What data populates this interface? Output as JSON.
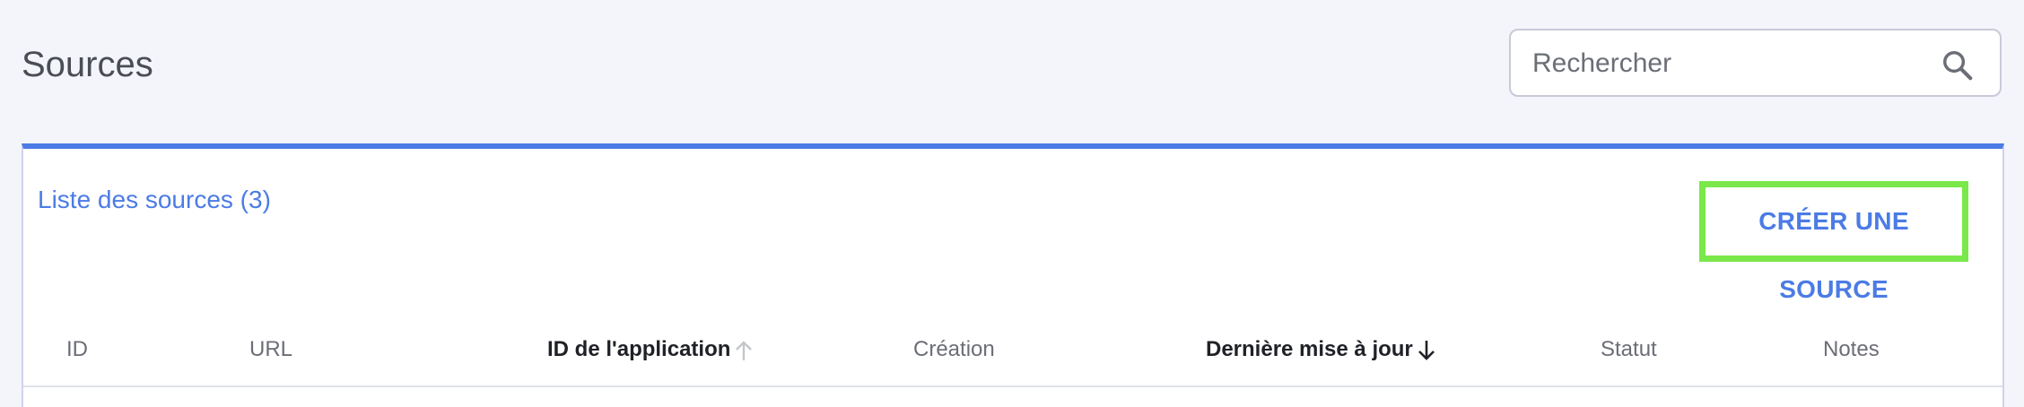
{
  "header": {
    "title": "Sources"
  },
  "search": {
    "placeholder": "Rechercher",
    "value": "",
    "icon": "search-icon"
  },
  "card": {
    "title": "Liste des sources (3)",
    "create_label": "CRÉER UNE SOURCE"
  },
  "table": {
    "columns": [
      {
        "label": "ID",
        "sort": "none"
      },
      {
        "label": "URL",
        "sort": "none"
      },
      {
        "label": "ID de l'application",
        "sort": "ascending-inactive"
      },
      {
        "label": "Création",
        "sort": "none"
      },
      {
        "label": "Dernière mise à jour",
        "sort": "descending-active"
      },
      {
        "label": "Statut",
        "sort": "none"
      },
      {
        "label": "Notes",
        "sort": "none"
      }
    ]
  },
  "colors": {
    "background": "#f4f5fa",
    "accent": "#4b7be5",
    "highlight_border": "#7ae84a",
    "text_muted": "#6b6e76",
    "text_strong": "#1f2126"
  }
}
